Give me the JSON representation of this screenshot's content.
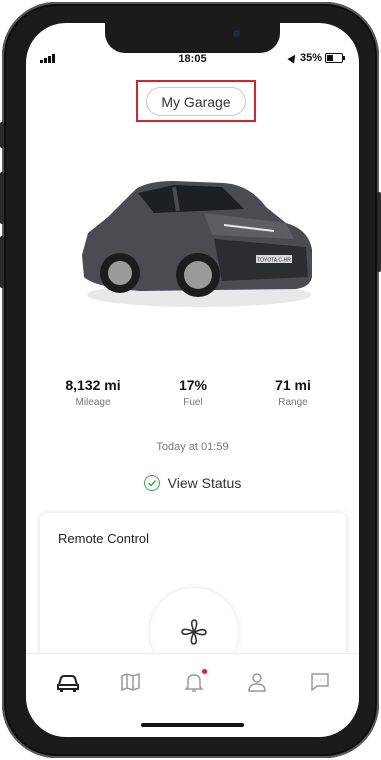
{
  "status_bar": {
    "time": "18:05",
    "battery": "35%"
  },
  "header": {
    "my_garage_label": "My Garage"
  },
  "vehicle": {
    "image": "car-image",
    "plate_text": "TOYOTA C-HR"
  },
  "stats": [
    {
      "value": "8,132 mi",
      "label": "Mileage"
    },
    {
      "value": "17%",
      "label": "Fuel"
    },
    {
      "value": "71 mi",
      "label": "Range"
    }
  ],
  "updated_text": "Today at 01:59",
  "view_status_label": "View Status",
  "remote_control": {
    "title": "Remote Control",
    "icon": "fan-icon"
  },
  "tab_bar": {
    "items": [
      {
        "icon": "car-icon"
      },
      {
        "icon": "map-icon"
      },
      {
        "icon": "bell-icon",
        "badge": true
      },
      {
        "icon": "user-icon"
      },
      {
        "icon": "chat-icon"
      }
    ]
  },
  "colors": {
    "accent_red": "#d6232d",
    "status_green": "#3aa655"
  }
}
